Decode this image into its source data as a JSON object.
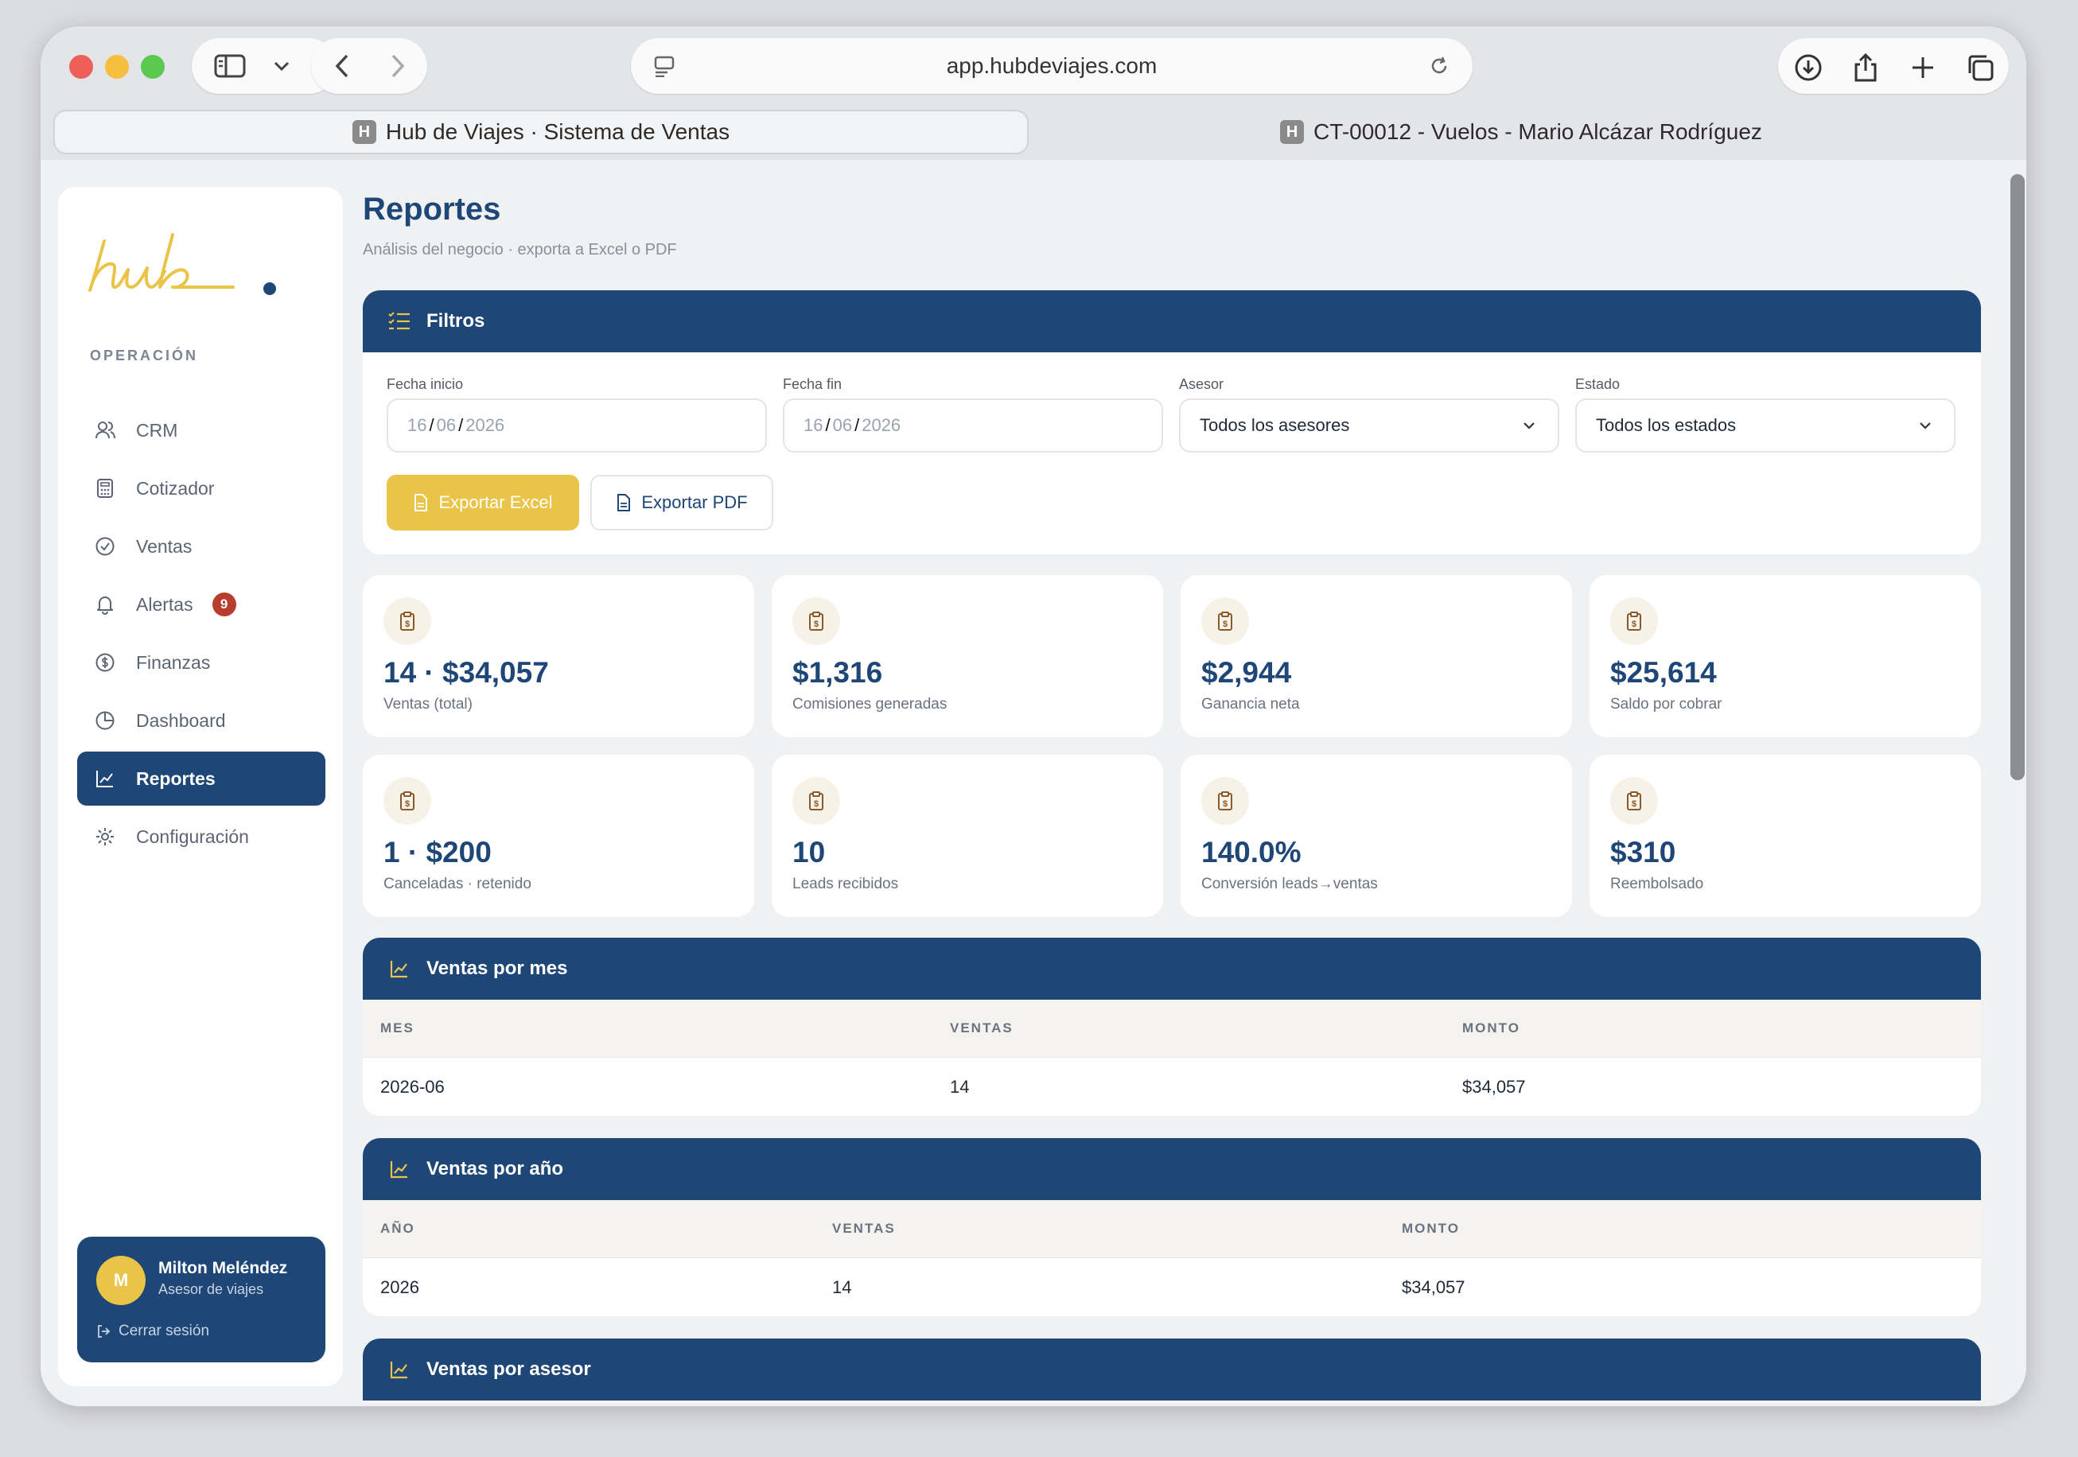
{
  "browser": {
    "url": "app.hubdeviajes.com",
    "tabs": [
      {
        "label": "Hub de Viajes · Sistema de Ventas",
        "icon_letter": "H"
      },
      {
        "label": "CT-00012 - Vuelos - Mario Alcázar Rodríguez",
        "icon_letter": "H"
      }
    ]
  },
  "sidebar": {
    "section": "OPERACIÓN",
    "items": [
      {
        "label": "CRM",
        "icon": "users-icon"
      },
      {
        "label": "Cotizador",
        "icon": "calculator-icon"
      },
      {
        "label": "Ventas",
        "icon": "check-circle-icon"
      },
      {
        "label": "Alertas",
        "icon": "bell-icon",
        "badge": "9"
      },
      {
        "label": "Finanzas",
        "icon": "dollar-circle-icon"
      },
      {
        "label": "Dashboard",
        "icon": "pie-chart-icon"
      },
      {
        "label": "Reportes",
        "icon": "line-chart-icon",
        "active": true
      },
      {
        "label": "Configuración",
        "icon": "sun-gear-icon"
      }
    ],
    "user": {
      "initial": "M",
      "name": "Milton Meléndez",
      "role": "Asesor de viajes",
      "logout": "Cerrar sesión"
    }
  },
  "page": {
    "title": "Reportes",
    "subtitle": "Análisis del negocio · exporta a Excel o PDF"
  },
  "filters": {
    "title": "Filtros",
    "start_label": "Fecha inicio",
    "start_value": {
      "d": "16",
      "m": "06",
      "y": "2026"
    },
    "end_label": "Fecha fin",
    "end_value": {
      "d": "16",
      "m": "06",
      "y": "2026"
    },
    "advisor_label": "Asesor",
    "advisor_value": "Todos los asesores",
    "status_label": "Estado",
    "status_value": "Todos los estados",
    "export_excel": "Exportar Excel",
    "export_pdf": "Exportar PDF"
  },
  "stats": [
    {
      "value": "14 · $34,057",
      "label": "Ventas (total)"
    },
    {
      "value": "$1,316",
      "label": "Comisiones generadas"
    },
    {
      "value": "$2,944",
      "label": "Ganancia neta"
    },
    {
      "value": "$25,614",
      "label": "Saldo por cobrar"
    },
    {
      "value": "1 · $200",
      "label": "Canceladas · retenido"
    },
    {
      "value": "10",
      "label": "Leads recibidos"
    },
    {
      "value": "140.0%",
      "label": "Conversión leads→ventas"
    },
    {
      "value": "$310",
      "label": "Reembolsado"
    }
  ],
  "by_month": {
    "title": "Ventas por mes",
    "headers": [
      "MES",
      "VENTAS",
      "MONTO"
    ],
    "rows": [
      [
        "2026-06",
        "14",
        "$34,057"
      ]
    ]
  },
  "by_year": {
    "title": "Ventas por año",
    "headers": [
      "AÑO",
      "VENTAS",
      "MONTO"
    ],
    "rows": [
      [
        "2026",
        "14",
        "$34,057"
      ]
    ]
  },
  "by_advisor": {
    "title": "Ventas por asesor"
  },
  "colors": {
    "primary": "#1e4677",
    "accent": "#e9c448",
    "badge": "#b73e2d"
  }
}
